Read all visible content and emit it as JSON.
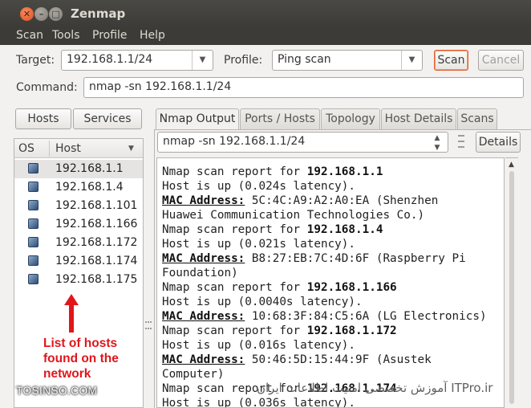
{
  "window": {
    "title": "Zenmap"
  },
  "menu": {
    "items": [
      "Scan",
      "Tools",
      "Profile",
      "Help"
    ]
  },
  "toolbar": {
    "target_label": "Target:",
    "target_value": "192.168.1.1/24",
    "profile_label": "Profile:",
    "profile_value": "Ping scan",
    "scan_label": "Scan",
    "cancel_label": "Cancel",
    "command_label": "Command:",
    "command_value": "nmap -sn 192.168.1.1/24"
  },
  "left_panel": {
    "hosts_button": "Hosts",
    "services_button": "Services",
    "columns": {
      "os": "OS",
      "host": "Host"
    },
    "hosts": [
      "192.168.1.1",
      "192.168.1.4",
      "192.168.1.101",
      "192.168.1.166",
      "192.168.1.172",
      "192.168.1.174",
      "192.168.1.175"
    ],
    "selected_host": "192.168.1.1"
  },
  "tabs": [
    "Nmap Output",
    "Ports / Hosts",
    "Topology",
    "Host Details",
    "Scans"
  ],
  "active_tab": "Nmap Output",
  "output": {
    "command_select": "nmap -sn 192.168.1.1/24",
    "details_button": "Details",
    "lines": [
      {
        "type": "report",
        "prefix": "Nmap scan report for ",
        "host": "192.168.1.1"
      },
      {
        "type": "plain",
        "text": "Host is up (0.024s latency)."
      },
      {
        "type": "mac",
        "label": "MAC Address:",
        "rest": " 5C:4C:A9:A2:A0:EA (Shenzhen"
      },
      {
        "type": "plain",
        "text": "Huawei Communication Technologies Co.)"
      },
      {
        "type": "report",
        "prefix": "Nmap scan report for ",
        "host": "192.168.1.4"
      },
      {
        "type": "plain",
        "text": "Host is up (0.021s latency)."
      },
      {
        "type": "mac",
        "label": "MAC Address:",
        "rest": " B8:27:EB:7C:4D:6F (Raspberry Pi"
      },
      {
        "type": "plain",
        "text": "Foundation)"
      },
      {
        "type": "report",
        "prefix": "Nmap scan report for ",
        "host": "192.168.1.166"
      },
      {
        "type": "plain",
        "text": "Host is up (0.0040s latency)."
      },
      {
        "type": "mac",
        "label": "MAC Address:",
        "rest": " 10:68:3F:84:C5:6A (LG Electronics)"
      },
      {
        "type": "report",
        "prefix": "Nmap scan report for ",
        "host": "192.168.1.172"
      },
      {
        "type": "plain",
        "text": "Host is up (0.016s latency)."
      },
      {
        "type": "mac",
        "label": "MAC Address:",
        "rest": " 50:46:5D:15:44:9F (Asustek"
      },
      {
        "type": "plain",
        "text": "Computer)"
      },
      {
        "type": "report",
        "prefix": "Nmap scan report for ",
        "host": "192.168.1.174"
      },
      {
        "type": "plain",
        "text": "Host is up (0.036s latency)."
      }
    ]
  },
  "annotation": {
    "text": "List of hosts found on the network",
    "color": "#e0161b"
  },
  "watermarks": {
    "left": "TOSINSO.COM",
    "right": "آموزش تخصصی امنیت اطلاعات ایران  ITPro.ir"
  }
}
